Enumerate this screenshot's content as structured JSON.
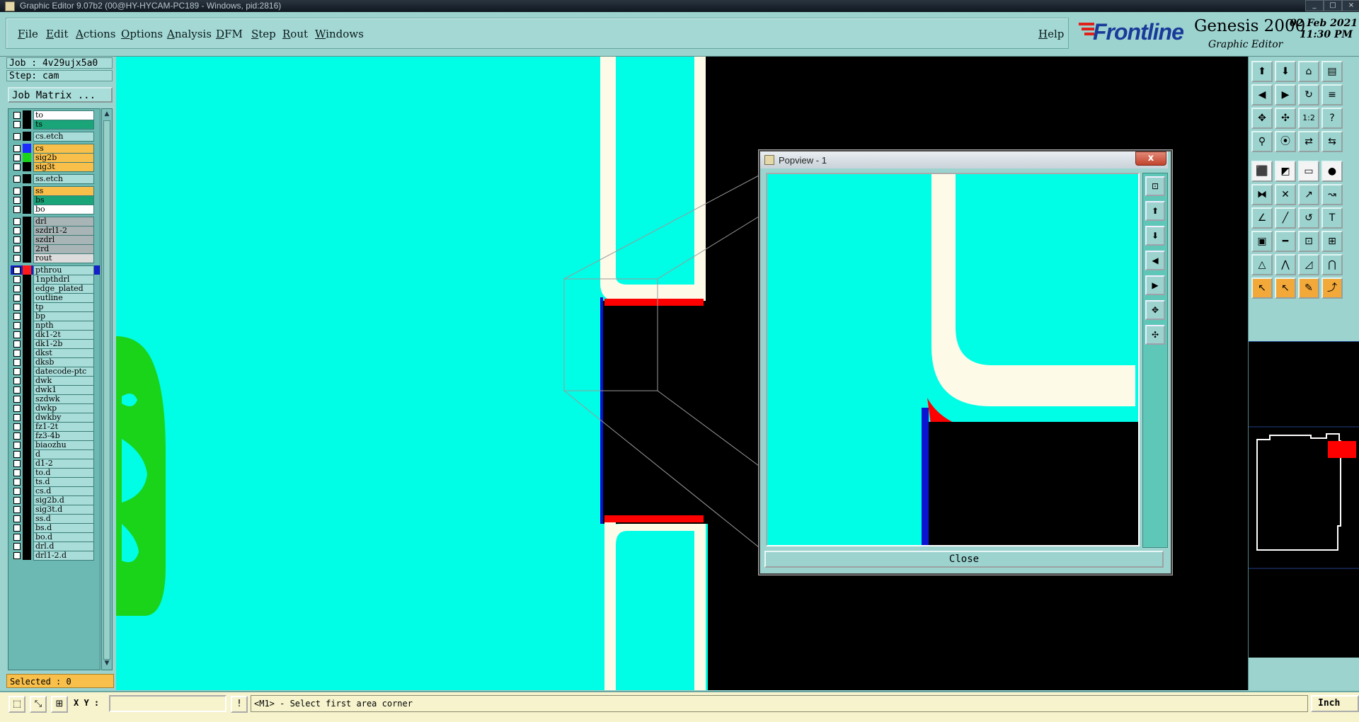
{
  "window": {
    "title": "Graphic Editor 9.07b2 (00@HY-HYCAM-PC189 - Windows, pid:2816)",
    "min_icon": "minimize-icon",
    "max_icon": "maximize-icon",
    "close_icon": "close-icon"
  },
  "menu": {
    "items": [
      "File",
      "Edit",
      "Actions",
      "Options",
      "Analysis",
      "DFM",
      "Step",
      "Rout",
      "Windows"
    ],
    "help": "Help"
  },
  "brand": {
    "logo": "Frontline",
    "product": "Genesis 2000",
    "subtitle": "Graphic Editor",
    "date": "02 Feb 2021",
    "time": "11:30 PM"
  },
  "job": {
    "job_label": "Job : 4v29ujx5a0",
    "step_label": "Step: cam",
    "job_matrix_button": "Job Matrix ..."
  },
  "layers": [
    {
      "name": "to",
      "color": "#ffffff",
      "swatch": "#000000"
    },
    {
      "name": "ts",
      "color": "#1aa579",
      "swatch": "#000000"
    },
    {
      "name": "cs.etch",
      "color": "#a8ddd9",
      "swatch": "#000000",
      "gap": true
    },
    {
      "name": "cs",
      "color": "#f8bf4a",
      "swatch": "#1c2cff",
      "gap": true
    },
    {
      "name": "sig2b",
      "color": "#f8bf4a",
      "swatch": "#1ad41a"
    },
    {
      "name": "sig3t",
      "color": "#f8bf4a",
      "swatch": "#000000"
    },
    {
      "name": "ss.etch",
      "color": "#a8ddd9",
      "swatch": "#000000",
      "gap": true
    },
    {
      "name": "ss",
      "color": "#f8bf4a",
      "swatch": "#000000",
      "gap": true
    },
    {
      "name": "bs",
      "color": "#1aa579",
      "swatch": "#000000"
    },
    {
      "name": "bo",
      "color": "#ffffff",
      "swatch": "#000000"
    },
    {
      "name": "drl",
      "color": "#a9b4b6",
      "swatch": "#000000",
      "gap": true
    },
    {
      "name": "szdrl1-2",
      "color": "#a9b4b6",
      "swatch": "#000000"
    },
    {
      "name": "szdrl",
      "color": "#a9b4b6",
      "swatch": "#000000"
    },
    {
      "name": "2rd",
      "color": "#a9b4b6",
      "swatch": "#000000"
    },
    {
      "name": "rout",
      "color": "#dcdcdc",
      "swatch": "#000000"
    },
    {
      "name": "pthrou",
      "color": "#a8ddd9",
      "swatch": "#ff1a1a",
      "gap": true,
      "active": true
    },
    {
      "name": "1npthdrl",
      "color": "#a8ddd9",
      "swatch": "#000000"
    },
    {
      "name": "edge_plated",
      "color": "#a8ddd9",
      "swatch": "#000000"
    },
    {
      "name": "outline",
      "color": "#a8ddd9",
      "swatch": "#000000"
    },
    {
      "name": "tp",
      "color": "#a8ddd9",
      "swatch": "#000000"
    },
    {
      "name": "bp",
      "color": "#a8ddd9",
      "swatch": "#000000"
    },
    {
      "name": "npth",
      "color": "#a8ddd9",
      "swatch": "#000000"
    },
    {
      "name": "dk1-2t",
      "color": "#a8ddd9",
      "swatch": "#000000"
    },
    {
      "name": "dk1-2b",
      "color": "#a8ddd9",
      "swatch": "#000000"
    },
    {
      "name": "dkst",
      "color": "#a8ddd9",
      "swatch": "#000000"
    },
    {
      "name": "dksb",
      "color": "#a8ddd9",
      "swatch": "#000000"
    },
    {
      "name": "datecode-ptc",
      "color": "#a8ddd9",
      "swatch": "#000000"
    },
    {
      "name": "dwk",
      "color": "#a8ddd9",
      "swatch": "#000000"
    },
    {
      "name": "dwk1",
      "color": "#a8ddd9",
      "swatch": "#000000"
    },
    {
      "name": "szdwk",
      "color": "#a8ddd9",
      "swatch": "#000000"
    },
    {
      "name": "dwkp",
      "color": "#a8ddd9",
      "swatch": "#000000"
    },
    {
      "name": "dwkby",
      "color": "#a8ddd9",
      "swatch": "#000000"
    },
    {
      "name": "fz1-2t",
      "color": "#a8ddd9",
      "swatch": "#000000"
    },
    {
      "name": "fz3-4b",
      "color": "#a8ddd9",
      "swatch": "#000000"
    },
    {
      "name": "biaozhu",
      "color": "#a8ddd9",
      "swatch": "#000000"
    },
    {
      "name": "d",
      "color": "#a8ddd9",
      "swatch": "#000000"
    },
    {
      "name": "d1-2",
      "color": "#a8ddd9",
      "swatch": "#000000"
    },
    {
      "name": "to.d",
      "color": "#a8ddd9",
      "swatch": "#000000"
    },
    {
      "name": "ts.d",
      "color": "#a8ddd9",
      "swatch": "#000000"
    },
    {
      "name": "cs.d",
      "color": "#a8ddd9",
      "swatch": "#000000"
    },
    {
      "name": "sig2b.d",
      "color": "#a8ddd9",
      "swatch": "#000000"
    },
    {
      "name": "sig3t.d",
      "color": "#a8ddd9",
      "swatch": "#000000"
    },
    {
      "name": "ss.d",
      "color": "#a8ddd9",
      "swatch": "#000000"
    },
    {
      "name": "bs.d",
      "color": "#a8ddd9",
      "swatch": "#000000"
    },
    {
      "name": "bo.d",
      "color": "#a8ddd9",
      "swatch": "#000000"
    },
    {
      "name": "drl.d",
      "color": "#a8ddd9",
      "swatch": "#000000"
    },
    {
      "name": "drl1-2.d",
      "color": "#a8ddd9",
      "swatch": "#000000"
    }
  ],
  "selected_label": "Selected : 0",
  "canvas_colors": {
    "copper": "#00fde6",
    "outline": "#fdfbe8",
    "highlight": "#ff0000",
    "edge": "#0a14d2",
    "board": "#1ad41a",
    "background": "#000000"
  },
  "popview": {
    "title": "Popview - 1",
    "close_x": "x",
    "close_button": "Close",
    "tools": [
      "zoom-fit-icon",
      "pan-up-icon",
      "pan-down-icon",
      "pan-left-icon",
      "pan-right-icon",
      "zoom-in-icon",
      "zoom-out-icon"
    ]
  },
  "right_toolbar": {
    "rows": [
      [
        "home-icon",
        "move-up-icon",
        "layer-icon",
        "panel-icon"
      ],
      [
        "prev-icon",
        "next-icon",
        "redo-icon",
        "snap-icon"
      ],
      [
        "fit-icon",
        "center-icon",
        "scale-icon",
        "help-icon"
      ],
      [
        "measure-icon",
        "probe-icon",
        "net-icon",
        "net2-icon"
      ],
      [
        "select-pad-icon",
        "select-area-icon",
        "ruler-icon",
        "circle-icon"
      ],
      [
        "connect-icon",
        "cross-icon",
        "arrow-point-icon",
        "link-icon"
      ],
      [
        "angle-icon",
        "line-icon",
        "arc-icon",
        "text-icon"
      ],
      [
        "pad-icon",
        "trace-icon",
        "via-icon",
        "component-icon"
      ],
      [
        "triangle-icon",
        "peak-icon",
        "ramp-icon",
        "bridge-icon"
      ],
      [
        "pointer-icon",
        "pointer-yellow-icon",
        "edit-icon",
        "route-icon"
      ]
    ],
    "scale_label": "1:2",
    "help_label": "?"
  },
  "statusbar": {
    "xy_label": "X Y :",
    "xy_value": "",
    "prompt": "<M1> - Select first area corner",
    "units": "Inch",
    "icons": [
      "area-select-icon",
      "measure-tool-icon",
      "grid-icon",
      "info-icon"
    ]
  }
}
